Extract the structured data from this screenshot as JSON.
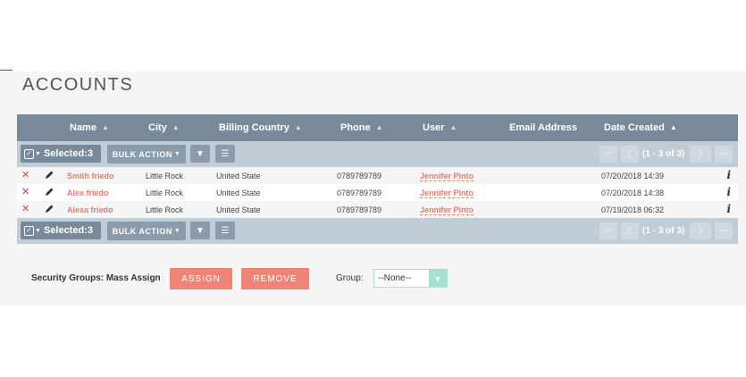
{
  "page": {
    "title": "ACCOUNTS"
  },
  "table": {
    "columns": [
      {
        "label": "Name",
        "sortable": true
      },
      {
        "label": "City",
        "sortable": true
      },
      {
        "label": "Billing Country",
        "sortable": true
      },
      {
        "label": "Phone",
        "sortable": true
      },
      {
        "label": "User",
        "sortable": true
      },
      {
        "label": "Email Address",
        "sortable": false
      },
      {
        "label": "Date Created",
        "sortable": true
      }
    ],
    "rows": [
      {
        "name": "Smith friedo",
        "city": "Little Rock",
        "country": "United State",
        "phone": "0789789789",
        "user": "Jennifer Pinto",
        "email": "",
        "date": "07/20/2018 14:39"
      },
      {
        "name": "Alex friedo",
        "city": "Little Rock",
        "country": "United State",
        "phone": "0789789789",
        "user": "Jennifer Pinto",
        "email": "",
        "date": "07/20/2018 14:38"
      },
      {
        "name": "Alexa friedo",
        "city": "Little Rock",
        "country": "United State",
        "phone": "0789789789",
        "user": "Jennifer Pinto",
        "email": "",
        "date": "07/19/2018 06:32"
      }
    ]
  },
  "actionbar": {
    "selected_label": "Selected:3",
    "bulk_label": "BULK ACTION",
    "pagination_top": "(1 - 3 of 3)",
    "pagination_bottom": "(1 - 3 of 3)"
  },
  "security": {
    "label": "Security Groups: Mass Assign",
    "assign_label": "ASSIGN",
    "remove_label": "REMOVE",
    "group_label": "Group:",
    "group_value": "--None--"
  },
  "icons": {
    "delete": "x-icon",
    "edit": "pencil-icon",
    "info": "info-icon",
    "filter": "filter-icon",
    "columns": "list-icon"
  },
  "colors": {
    "header": "#788a9a",
    "actionbar": "#c1cdd6",
    "link": "#e27e6f",
    "button": "#f08377",
    "select_accent": "#a5e1d2"
  }
}
